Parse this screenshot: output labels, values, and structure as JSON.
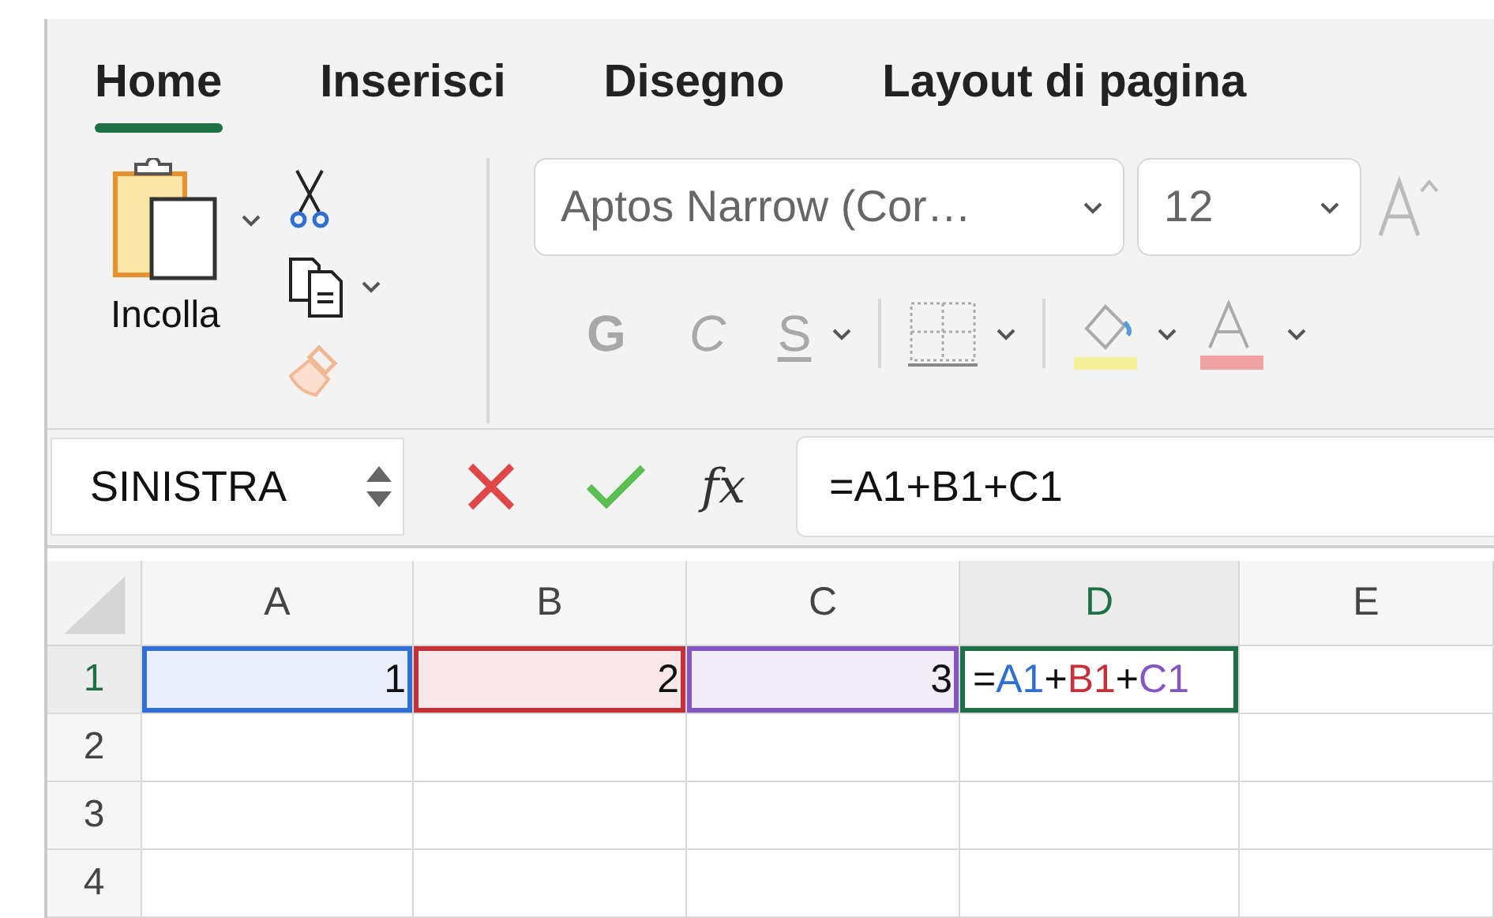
{
  "tabs": [
    {
      "label": "Home",
      "selected": true
    },
    {
      "label": "Inserisci",
      "selected": false
    },
    {
      "label": "Disegno",
      "selected": false
    },
    {
      "label": "Layout di pagina",
      "selected": false
    }
  ],
  "clipboard": {
    "paste_label": "Incolla"
  },
  "font": {
    "name": "Aptos Narrow (Cor…",
    "size": "12"
  },
  "format_buttons": [
    {
      "kind": "bold",
      "label": "G",
      "disabled": true
    },
    {
      "kind": "italic",
      "label": "C",
      "disabled": true
    },
    {
      "kind": "underline",
      "label": "S",
      "disabled": true
    }
  ],
  "name_box": {
    "value": "SINISTRA"
  },
  "formula_bar": {
    "fx": "fx",
    "value": "=A1+B1+C1"
  },
  "grid": {
    "columns": [
      {
        "label": "A",
        "selected": false
      },
      {
        "label": "B",
        "selected": false
      },
      {
        "label": "C",
        "selected": false
      },
      {
        "label": "D",
        "selected": true
      },
      {
        "label": "E",
        "selected": false
      }
    ],
    "rows": [
      {
        "label": "1",
        "selected": true,
        "cells": [
          {
            "kind": "value",
            "value": "1",
            "color": "#2e6fd1"
          },
          {
            "kind": "value",
            "value": "2",
            "color": "#c4313b"
          },
          {
            "kind": "value",
            "value": "3",
            "color": "#8356c0"
          },
          {
            "kind": "formula",
            "active": true,
            "parts": [
              {
                "text": "="
              },
              {
                "text": "A1",
                "color": "#2e6fd1"
              },
              {
                "text": "+"
              },
              {
                "text": "B1",
                "color": "#c4313b"
              },
              {
                "text": "+"
              },
              {
                "text": "C1",
                "color": "#8356c0"
              }
            ]
          }
        ]
      },
      {
        "label": "2",
        "selected": false
      },
      {
        "label": "3",
        "selected": false
      },
      {
        "label": "4",
        "selected": false
      }
    ]
  }
}
